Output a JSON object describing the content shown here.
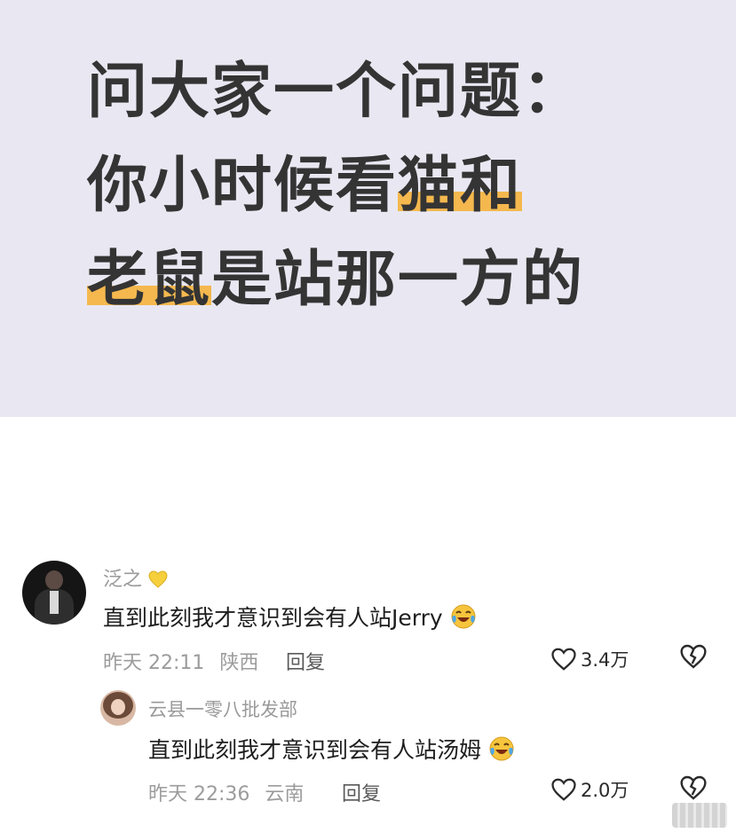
{
  "question": {
    "line1": "问大家一个问题：",
    "line2_a": "你小时候看",
    "line2_b": "猫和",
    "line3_a": "老鼠",
    "line3_b": "是站那一方的",
    "highlight_color": "#f4b84e",
    "background_color": "#e9e8f2"
  },
  "comment": {
    "username": "泛之",
    "badge_icon": "yellow-heart-icon",
    "text": "直到此刻我才意识到会有人站Jerry",
    "emoji_icon": "laughing-crying-face-icon",
    "time": "昨天 22:11",
    "location": "陕西",
    "reply_label": "回复",
    "like_count": "3.4万"
  },
  "reply": {
    "username": "云县一零八批发部",
    "text": "直到此刻我才意识到会有人站汤姆",
    "emoji_icon": "laughing-crying-face-icon",
    "time": "昨天 22:36",
    "location": "云南",
    "reply_label": "回复",
    "like_count": "2.0万"
  }
}
